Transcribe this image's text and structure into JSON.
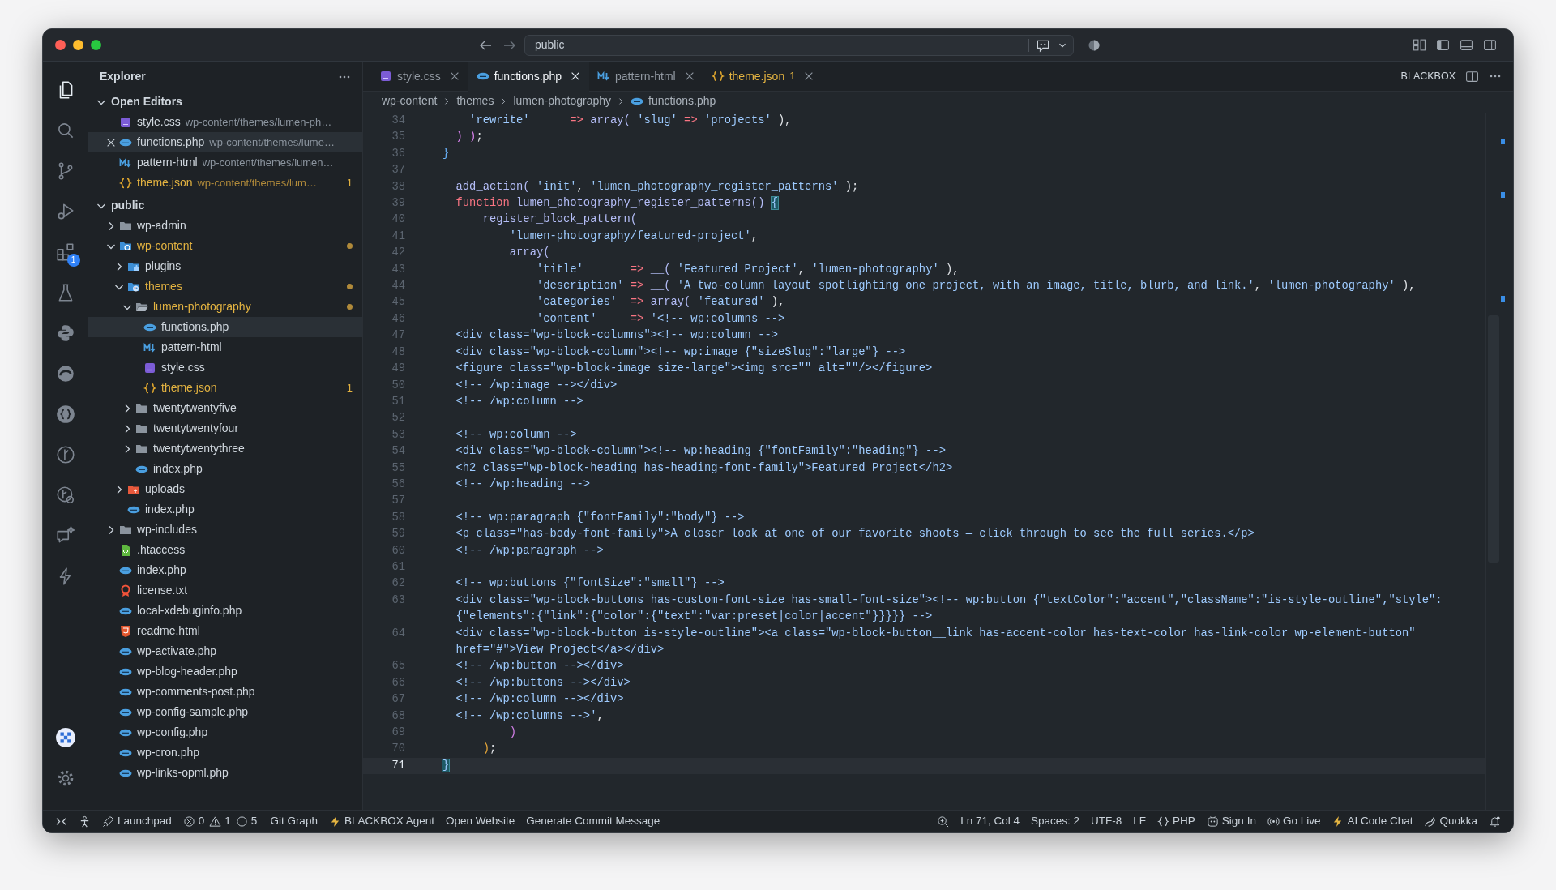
{
  "window": {
    "command_center": {
      "value": "public"
    }
  },
  "activity_bar": {
    "items": [
      {
        "kind": "explorer",
        "selected": true
      },
      {
        "kind": "search",
        "selected": false
      },
      {
        "kind": "source-control",
        "selected": false
      },
      {
        "kind": "run-debug",
        "selected": false
      },
      {
        "kind": "extensions",
        "selected": false,
        "badge": "1"
      },
      {
        "kind": "testing",
        "selected": false
      },
      {
        "kind": "python",
        "selected": false
      },
      {
        "kind": "edge",
        "selected": false
      },
      {
        "kind": "json",
        "selected": false
      },
      {
        "kind": "git-graph",
        "selected": false
      },
      {
        "kind": "timeline",
        "selected": false
      },
      {
        "kind": "chat",
        "selected": false
      },
      {
        "kind": "bolt",
        "selected": false
      }
    ],
    "bottom": [
      {
        "kind": "account"
      },
      {
        "kind": "settings"
      }
    ]
  },
  "sidebar": {
    "title": "Explorer",
    "open_editors": {
      "label": "Open Editors",
      "expanded": true,
      "items": [
        {
          "name": "style.css",
          "path": "wp-content/themes/lumen-ph…",
          "kind": "css",
          "selected": false,
          "modified": false
        },
        {
          "name": "functions.php",
          "path": "wp-content/themes/lume…",
          "kind": "php",
          "selected": true,
          "modified": false
        },
        {
          "name": "pattern-html",
          "path": "wp-content/themes/lumen…",
          "kind": "markdown",
          "selected": false,
          "modified": false
        },
        {
          "name": "theme.json",
          "path": "wp-content/themes/lum…",
          "kind": "json",
          "selected": false,
          "modified": true,
          "problems": "1"
        }
      ]
    },
    "folder": {
      "label": "public",
      "expanded": true,
      "tree": [
        {
          "name": "wp-admin",
          "kind": "folder",
          "expanded": false,
          "selected": false,
          "modified": false
        },
        {
          "name": "wp-content",
          "kind": "wordpress-folder",
          "expanded": true,
          "selected": false,
          "modified": true,
          "children": [
            {
              "name": "plugins",
              "kind": "plugins-folder",
              "expanded": false,
              "selected": false,
              "modified": false
            },
            {
              "name": "themes",
              "kind": "themes-folder",
              "expanded": true,
              "selected": false,
              "modified": true,
              "children": [
                {
                  "name": "lumen-photography",
                  "kind": "folder",
                  "expanded": true,
                  "selected": false,
                  "modified": true,
                  "children": [
                    {
                      "name": "functions.php",
                      "kind": "php",
                      "selected": true,
                      "modified": false
                    },
                    {
                      "name": "pattern-html",
                      "kind": "markdown",
                      "selected": false,
                      "modified": false
                    },
                    {
                      "name": "style.css",
                      "kind": "css",
                      "selected": false,
                      "modified": false
                    },
                    {
                      "name": "theme.json",
                      "kind": "json",
                      "selected": false,
                      "modified": true,
                      "problems": "1"
                    }
                  ]
                },
                {
                  "name": "twentytwentyfive",
                  "kind": "folder",
                  "expanded": false,
                  "selected": false,
                  "modified": false
                },
                {
                  "name": "twentytwentyfour",
                  "kind": "folder",
                  "expanded": false,
                  "selected": false,
                  "modified": false
                },
                {
                  "name": "twentytwentythree",
                  "kind": "folder",
                  "expanded": false,
                  "selected": false,
                  "modified": false
                },
                {
                  "name": "index.php",
                  "kind": "php",
                  "selected": false,
                  "modified": false
                }
              ]
            },
            {
              "name": "uploads",
              "kind": "uploads-folder",
              "expanded": false,
              "selected": false,
              "modified": false
            },
            {
              "name": "index.php",
              "kind": "php",
              "selected": false,
              "modified": false
            }
          ]
        },
        {
          "name": "wp-includes",
          "kind": "folder",
          "expanded": false,
          "selected": false,
          "modified": false
        },
        {
          "name": ".htaccess",
          "kind": "htaccess",
          "selected": false,
          "modified": false
        },
        {
          "name": "index.php",
          "kind": "php",
          "selected": false,
          "modified": false
        },
        {
          "name": "license.txt",
          "kind": "license",
          "selected": false,
          "modified": false
        },
        {
          "name": "local-xdebuginfo.php",
          "kind": "php",
          "selected": false,
          "modified": false
        },
        {
          "name": "readme.html",
          "kind": "html",
          "selected": false,
          "modified": false
        },
        {
          "name": "wp-activate.php",
          "kind": "php",
          "selected": false,
          "modified": false
        },
        {
          "name": "wp-blog-header.php",
          "kind": "php",
          "selected": false,
          "modified": false
        },
        {
          "name": "wp-comments-post.php",
          "kind": "php",
          "selected": false,
          "modified": false
        },
        {
          "name": "wp-config-sample.php",
          "kind": "php",
          "selected": false,
          "modified": false
        },
        {
          "name": "wp-config.php",
          "kind": "php",
          "selected": false,
          "modified": false
        },
        {
          "name": "wp-cron.php",
          "kind": "php",
          "selected": false,
          "modified": false
        },
        {
          "name": "wp-links-opml.php",
          "kind": "php",
          "selected": false,
          "modified": false
        }
      ]
    }
  },
  "editor": {
    "tabs": [
      {
        "name": "style.css",
        "kind": "css",
        "selected": false,
        "modified": false
      },
      {
        "name": "functions.php",
        "kind": "php",
        "selected": true,
        "modified": false
      },
      {
        "name": "pattern-html",
        "kind": "markdown",
        "selected": false,
        "modified": false
      },
      {
        "name": "theme.json",
        "kind": "json",
        "selected": false,
        "modified": true,
        "problems": "1"
      }
    ],
    "actions": {
      "label": "BLACKBOX"
    },
    "breadcrumb": [
      {
        "text": "wp-content"
      },
      {
        "text": "themes"
      },
      {
        "text": "lumen-photography"
      },
      {
        "text": "functions.php",
        "kind": "php"
      }
    ],
    "lines": [
      {
        "number": "34",
        "current": false,
        "tokens": [
          {
            "text": "    'rewrite'",
            "kind": "string"
          },
          {
            "text": "      =>",
            "kind": "operator"
          },
          {
            "text": " array(",
            "kind": "function"
          },
          {
            "text": " 'slug'",
            "kind": "string"
          },
          {
            "text": " =>",
            "kind": "operator"
          },
          {
            "text": " 'projects'",
            "kind": "string"
          },
          {
            "text": " ),",
            "kind": "plain"
          }
        ]
      },
      {
        "number": "35",
        "current": false,
        "tokens": [
          {
            "text": "  ) )",
            "kind": "bracket2"
          },
          {
            "text": ";",
            "kind": "plain"
          }
        ]
      },
      {
        "number": "36",
        "current": false,
        "tokens": [
          {
            "text": "}",
            "kind": "bracket3"
          }
        ]
      },
      {
        "number": "37",
        "current": false
      },
      {
        "number": "38",
        "current": false,
        "tokens": [
          {
            "text": "  add_action(",
            "kind": "function"
          },
          {
            "text": " 'init'",
            "kind": "string"
          },
          {
            "text": ",",
            "kind": "plain"
          },
          {
            "text": " 'lumen_photography_register_patterns'",
            "kind": "string"
          },
          {
            "text": " );",
            "kind": "plain"
          }
        ]
      },
      {
        "number": "39",
        "current": false,
        "tokens": [
          {
            "text": "  function",
            "kind": "keyword"
          },
          {
            "text": " lumen_photography_register_patterns() ",
            "kind": "function"
          },
          {
            "text": "{",
            "kind": "match"
          }
        ]
      },
      {
        "number": "40",
        "current": false,
        "tokens": [
          {
            "text": "      register_block_pattern(",
            "kind": "function"
          }
        ]
      },
      {
        "number": "41",
        "current": false,
        "tokens": [
          {
            "text": "          'lumen-photography/featured-project'",
            "kind": "string"
          },
          {
            "text": ",",
            "kind": "plain"
          }
        ]
      },
      {
        "number": "42",
        "current": false,
        "tokens": [
          {
            "text": "          array(",
            "kind": "function"
          }
        ]
      },
      {
        "number": "43",
        "current": false,
        "tokens": [
          {
            "text": "              'title'",
            "kind": "string"
          },
          {
            "text": "       =>",
            "kind": "operator"
          },
          {
            "text": " __(",
            "kind": "function"
          },
          {
            "text": " 'Featured Project'",
            "kind": "string"
          },
          {
            "text": ",",
            "kind": "plain"
          },
          {
            "text": " 'lumen-photography'",
            "kind": "string"
          },
          {
            "text": " ),",
            "kind": "plain"
          }
        ]
      },
      {
        "number": "44",
        "current": false,
        "tokens": [
          {
            "text": "              'description'",
            "kind": "string"
          },
          {
            "text": " =>",
            "kind": "operator"
          },
          {
            "text": " __(",
            "kind": "function"
          },
          {
            "text": " 'A two-column layout spotlighting one project, with an image, title, blurb, and link.'",
            "kind": "string"
          },
          {
            "text": ",",
            "kind": "plain"
          },
          {
            "text": " 'lumen-photography'",
            "kind": "string"
          },
          {
            "text": " ),",
            "kind": "plain"
          }
        ]
      },
      {
        "number": "45",
        "current": false,
        "tokens": [
          {
            "text": "              'categories'",
            "kind": "string"
          },
          {
            "text": "  =>",
            "kind": "operator"
          },
          {
            "text": " array(",
            "kind": "function"
          },
          {
            "text": " 'featured'",
            "kind": "string"
          },
          {
            "text": " ),",
            "kind": "plain"
          }
        ]
      },
      {
        "number": "46",
        "current": false,
        "tokens": [
          {
            "text": "              'content'",
            "kind": "string"
          },
          {
            "text": "     =>",
            "kind": "operator"
          },
          {
            "text": " '<!-- wp:columns -->",
            "kind": "string"
          }
        ]
      },
      {
        "number": "47",
        "current": false,
        "tokens": [
          {
            "text": "  <div class=\"wp-block-columns\"><!-- wp:column -->",
            "kind": "string"
          }
        ]
      },
      {
        "number": "48",
        "current": false,
        "tokens": [
          {
            "text": "  <div class=\"wp-block-column\"><!-- wp:image {\"sizeSlug\":\"large\"} -->",
            "kind": "string"
          }
        ]
      },
      {
        "number": "49",
        "current": false,
        "tokens": [
          {
            "text": "  <figure class=\"wp-block-image size-large\"><img src=\"\" alt=\"\"/></figure>",
            "kind": "string"
          }
        ]
      },
      {
        "number": "50",
        "current": false,
        "tokens": [
          {
            "text": "  <!-- /wp:image --></div>",
            "kind": "string"
          }
        ]
      },
      {
        "number": "51",
        "current": false,
        "tokens": [
          {
            "text": "  <!-- /wp:column -->",
            "kind": "string"
          }
        ]
      },
      {
        "number": "52",
        "current": false
      },
      {
        "number": "53",
        "current": false,
        "tokens": [
          {
            "text": "  <!-- wp:column -->",
            "kind": "string"
          }
        ]
      },
      {
        "number": "54",
        "current": false,
        "tokens": [
          {
            "text": "  <div class=\"wp-block-column\"><!-- wp:heading {\"fontFamily\":\"heading\"} -->",
            "kind": "string"
          }
        ]
      },
      {
        "number": "55",
        "current": false,
        "tokens": [
          {
            "text": "  <h2 class=\"wp-block-heading has-heading-font-family\">Featured Project</h2>",
            "kind": "string"
          }
        ]
      },
      {
        "number": "56",
        "current": false,
        "tokens": [
          {
            "text": "  <!-- /wp:heading -->",
            "kind": "string"
          }
        ]
      },
      {
        "number": "57",
        "current": false
      },
      {
        "number": "58",
        "current": false,
        "tokens": [
          {
            "text": "  <!-- wp:paragraph {\"fontFamily\":\"body\"} -->",
            "kind": "string"
          }
        ]
      },
      {
        "number": "59",
        "current": false,
        "tokens": [
          {
            "text": "  <p class=\"has-body-font-family\">A closer look at one of our favorite shoots — click through to see the full series.</p>",
            "kind": "string"
          }
        ]
      },
      {
        "number": "60",
        "current": false,
        "tokens": [
          {
            "text": "  <!-- /wp:paragraph -->",
            "kind": "string"
          }
        ]
      },
      {
        "number": "61",
        "current": false
      },
      {
        "number": "62",
        "current": false,
        "tokens": [
          {
            "text": "  <!-- wp:buttons {\"fontSize\":\"small\"} -->",
            "kind": "string"
          }
        ]
      },
      {
        "number": "63",
        "current": false,
        "rows": [
          "  <div class=\"wp-block-buttons has-custom-font-size has-small-font-size\"><!-- wp:button {\"textColor\":\"accent\",\"className\":\"is-style-outline\",\"style\":",
          "  {\"elements\":{\"link\":{\"color\":{\"text\":\"var:preset|color|accent\"}}}}} -->"
        ]
      },
      {
        "number": "64",
        "current": false,
        "rows": [
          "  <div class=\"wp-block-button is-style-outline\"><a class=\"wp-block-button__link has-accent-color has-text-color has-link-color wp-element-button\"",
          "  href=\"#\">View Project</a></div>"
        ]
      },
      {
        "number": "65",
        "current": false,
        "tokens": [
          {
            "text": "  <!-- /wp:button --></div>",
            "kind": "string"
          }
        ]
      },
      {
        "number": "66",
        "current": false,
        "tokens": [
          {
            "text": "  <!-- /wp:buttons --></div>",
            "kind": "string"
          }
        ]
      },
      {
        "number": "67",
        "current": false,
        "tokens": [
          {
            "text": "  <!-- /wp:column --></div>",
            "kind": "string"
          }
        ]
      },
      {
        "number": "68",
        "current": false,
        "tokens": [
          {
            "text": "  <!-- /wp:columns -->'",
            "kind": "string"
          },
          {
            "text": ",",
            "kind": "plain"
          }
        ]
      },
      {
        "number": "69",
        "current": false,
        "tokens": [
          {
            "text": "          )",
            "kind": "bracket2"
          }
        ]
      },
      {
        "number": "70",
        "current": false,
        "tokens": [
          {
            "text": "      )",
            "kind": "bracket1"
          },
          {
            "text": ";",
            "kind": "plain"
          }
        ]
      },
      {
        "number": "71",
        "current": true,
        "tokens": [
          {
            "text": "}",
            "kind": "match"
          }
        ]
      }
    ]
  },
  "status_bar": {
    "left": [
      {
        "kind": "remote"
      },
      {
        "kind": "person"
      },
      {
        "kind": "rocket",
        "text": "Launchpad"
      },
      {
        "kind": "problems",
        "errors": "0",
        "warnings": "1",
        "infos": "5"
      },
      {
        "text": "Git Graph"
      },
      {
        "kind": "bolt",
        "text": "BLACKBOX Agent"
      },
      {
        "text": "Open Website"
      },
      {
        "text": "Generate Commit Message"
      }
    ],
    "right": [
      {
        "kind": "zoom"
      },
      {
        "text": "Ln 71, Col 4"
      },
      {
        "text": "Spaces: 2"
      },
      {
        "text": "UTF-8"
      },
      {
        "text": "LF"
      },
      {
        "kind": "braces",
        "text": "PHP"
      },
      {
        "kind": "account",
        "text": "Sign In"
      },
      {
        "kind": "broadcast",
        "text": "Go Live"
      },
      {
        "kind": "bolt",
        "text": "AI Code Chat"
      },
      {
        "kind": "quokka",
        "text": "Quokka"
      },
      {
        "kind": "bell"
      }
    ]
  }
}
